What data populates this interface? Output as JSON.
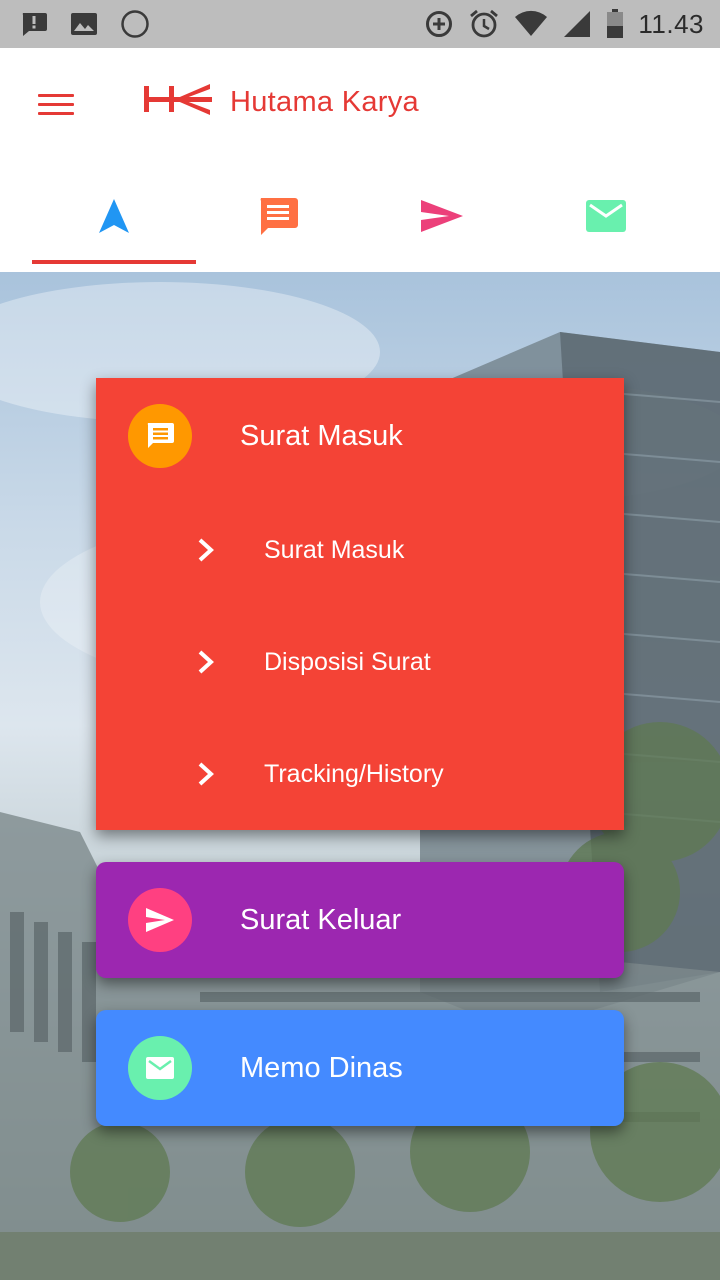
{
  "status_bar": {
    "time": "11.43",
    "left_icons": [
      "message-alert-icon",
      "image-icon",
      "circle-icon"
    ],
    "right_icons": [
      "data-saver-icon",
      "alarm-icon",
      "wifi-icon",
      "signal-icon",
      "battery-icon"
    ]
  },
  "app_bar": {
    "title": "Hutama Karya",
    "logo_icon": "hk-logo-icon",
    "menu_icon": "hamburger-menu-icon"
  },
  "tabs": [
    {
      "icon": "navigation-arrow-icon",
      "color": "#2196f3",
      "selected": true
    },
    {
      "icon": "chat-message-icon",
      "color": "#ff7043",
      "selected": false
    },
    {
      "icon": "send-icon",
      "color": "#ec407a",
      "selected": false
    },
    {
      "icon": "mail-icon",
      "color": "#69f0ae",
      "selected": false
    }
  ],
  "cards": {
    "surat_masuk": {
      "title": "Surat Masuk",
      "color": "#f44336",
      "icon": "chat-message-icon",
      "icon_bg": "#ff9800",
      "items": [
        {
          "label": "Surat Masuk"
        },
        {
          "label": "Disposisi Surat"
        },
        {
          "label": "Tracking/History"
        }
      ]
    },
    "surat_keluar": {
      "title": "Surat Keluar",
      "color": "#9c27b0",
      "icon": "send-icon",
      "icon_bg": "#ff4081"
    },
    "memo_dinas": {
      "title": "Memo Dinas",
      "color": "#448aff",
      "icon": "mail-icon",
      "icon_bg": "#69f0ae"
    }
  },
  "colors": {
    "accent": "#e53935",
    "status_bar": "#bdbdbd"
  }
}
